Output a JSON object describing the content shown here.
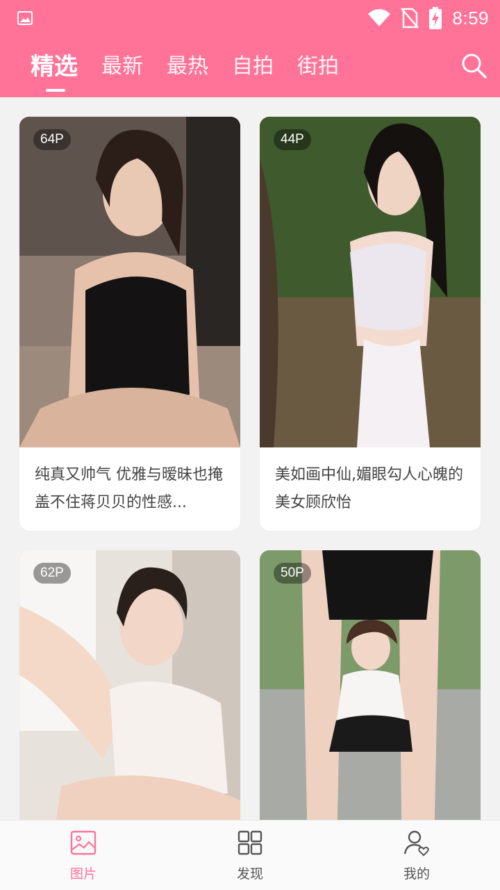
{
  "colors": {
    "brand": "#ff7399",
    "background": "#f2f2f2",
    "nav_active": "#ff7399",
    "nav_inactive": "#555555"
  },
  "status_bar": {
    "time": "8:59",
    "icons": [
      "image-icon",
      "wifi-icon",
      "no-sim-icon",
      "battery-charging-icon"
    ]
  },
  "tabs": [
    {
      "label": "精选",
      "active": true
    },
    {
      "label": "最新",
      "active": false
    },
    {
      "label": "最热",
      "active": false
    },
    {
      "label": "自拍",
      "active": false
    },
    {
      "label": "街拍",
      "active": false
    }
  ],
  "search": {
    "icon": "search-icon"
  },
  "cards": [
    {
      "count": "64P",
      "title": "纯真又帅气 优雅与暧昧也掩盖不住蒋贝贝的性感..."
    },
    {
      "count": "44P",
      "title": "美如画中仙,媚眼勾人心魄的美女顾欣怡"
    },
    {
      "count": "62P",
      "title": ""
    },
    {
      "count": "50P",
      "title": ""
    }
  ],
  "bottom_nav": [
    {
      "label": "图片",
      "icon": "picture-icon",
      "active": true
    },
    {
      "label": "发现",
      "icon": "grid-icon",
      "active": false
    },
    {
      "label": "我的",
      "icon": "user-heart-icon",
      "active": false
    }
  ]
}
